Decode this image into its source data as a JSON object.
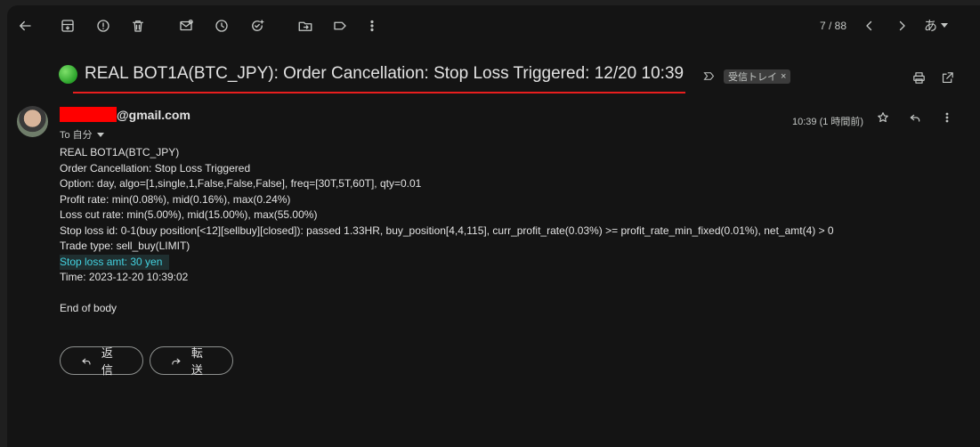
{
  "toolbar": {
    "counter": "7 / 88",
    "ime_label": "あ"
  },
  "subject": {
    "text": "REAL BOT1A(BTC_JPY): Order Cancellation: Stop Loss Triggered: 12/20 10:39",
    "status_color": "#2aa22a",
    "label_chip": "受信トレイ",
    "chip_close": "×"
  },
  "message": {
    "sender_suffix": "@gmail.com",
    "to_label": "To 自分",
    "timestamp": "10:39 (1 時間前)",
    "body": {
      "line1": "REAL BOT1A(BTC_JPY)",
      "line2": "Order Cancellation: Stop Loss Triggered",
      "line3": "Option: day, algo=[1,single,1,False,False,False], freq=[30T,5T,60T], qty=0.01",
      "line4": "Profit rate: min(0.08%), mid(0.16%), max(0.24%)",
      "line5": "Loss cut rate: min(5.00%), mid(15.00%), max(55.00%)",
      "line6": "Stop loss id: 0-1(buy position[<12][sellbuy][closed]): passed 1.33HR, buy_position[4,4,115], curr_profit_rate(0.03%) >= profit_rate_min_fixed(0.01%), net_amt(4) > 0",
      "line7": "Trade type: sell_buy(LIMIT)",
      "line8": "Stop loss amt: 30 yen",
      "line9": "Time: 2023-12-20 10:39:02",
      "line10": "End of body"
    }
  },
  "actions": {
    "reply_label": "返信",
    "forward_label": "転送"
  },
  "colors": {
    "background": "#141414",
    "highlight_text": "#43d2e0",
    "redaction": "#ff0000",
    "underline": "#e81e1e"
  }
}
